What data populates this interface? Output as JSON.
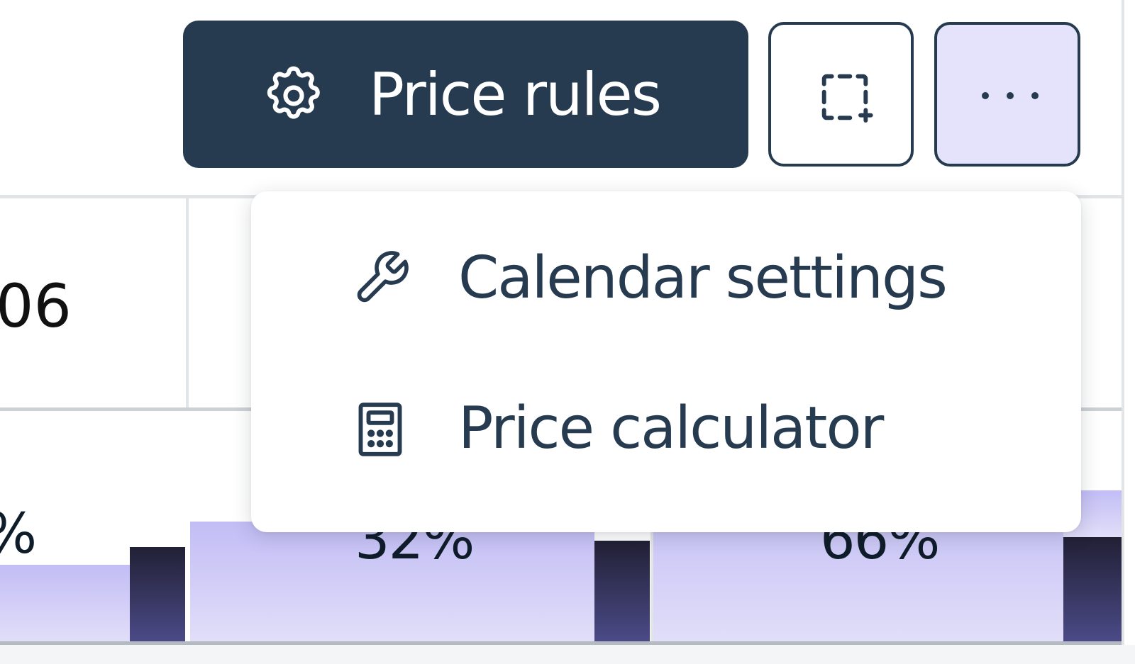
{
  "toolbar": {
    "price_rules_label": "Price rules",
    "price_rules_icon": "gear-icon",
    "select_icon": "selection-add-icon",
    "more_icon": "more-horizontal-icon"
  },
  "grid": {
    "cell_value_partial": "06",
    "percents": [
      "%",
      "32%",
      "66%"
    ]
  },
  "menu": {
    "items": [
      {
        "label": "Calendar settings",
        "icon": "wrench-icon"
      },
      {
        "label": "Price calculator",
        "icon": "calculator-icon"
      }
    ]
  },
  "colors": {
    "primary": "#263b4f",
    "accent_light": "#e4e3fb",
    "bar_fill": "#c2bdf5",
    "bar_dark": "#2a2946"
  }
}
